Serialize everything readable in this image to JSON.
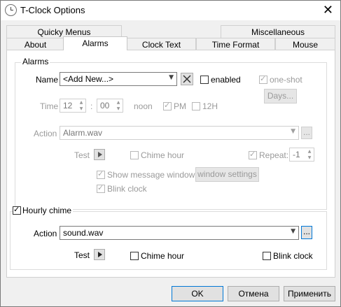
{
  "window": {
    "title": "T-Clock Options",
    "close_glyph": "✕"
  },
  "tabs": {
    "row1": [
      "Quicky Menus",
      "Miscellaneous"
    ],
    "row2": [
      "About",
      "Alarms",
      "Clock Text",
      "Time Format",
      "Mouse"
    ],
    "active": "Alarms"
  },
  "alarms": {
    "group_label": "Alarms",
    "name_label": "Name",
    "name_value": "<Add New...>",
    "enabled_label": "enabled",
    "oneshot_label": "one-shot",
    "days_button": "Days...",
    "time_label": "Time",
    "hour": "12",
    "minute": "00",
    "colon": ":",
    "noon_label": "noon",
    "pm_label": "PM",
    "h12_label": "12H",
    "action_label": "Action",
    "action_value": "Alarm.wav",
    "browse_label": "...",
    "test_label": "Test",
    "chime_hour_label": "Chime hour",
    "repeat_label": "Repeat:",
    "repeat_value": "-1",
    "show_message_label": "Show message window",
    "window_settings_button": "window settings",
    "blink_clock_label": "Blink clock"
  },
  "hourly": {
    "group_label": "Hourly chime",
    "action_label": "Action",
    "action_value": "sound.wav",
    "browse_label": "...",
    "test_label": "Test",
    "chime_hour_label": "Chime hour",
    "blink_clock_label": "Blink clock"
  },
  "footer": {
    "ok": "OK",
    "cancel": "Отмена",
    "apply": "Применить"
  },
  "check_glyph": "✓",
  "colors": {
    "accent": "#0078d7",
    "disabled_text": "#9a9a9a",
    "panel_bg": "#ffffff",
    "window_bg": "#f0f0f0"
  }
}
